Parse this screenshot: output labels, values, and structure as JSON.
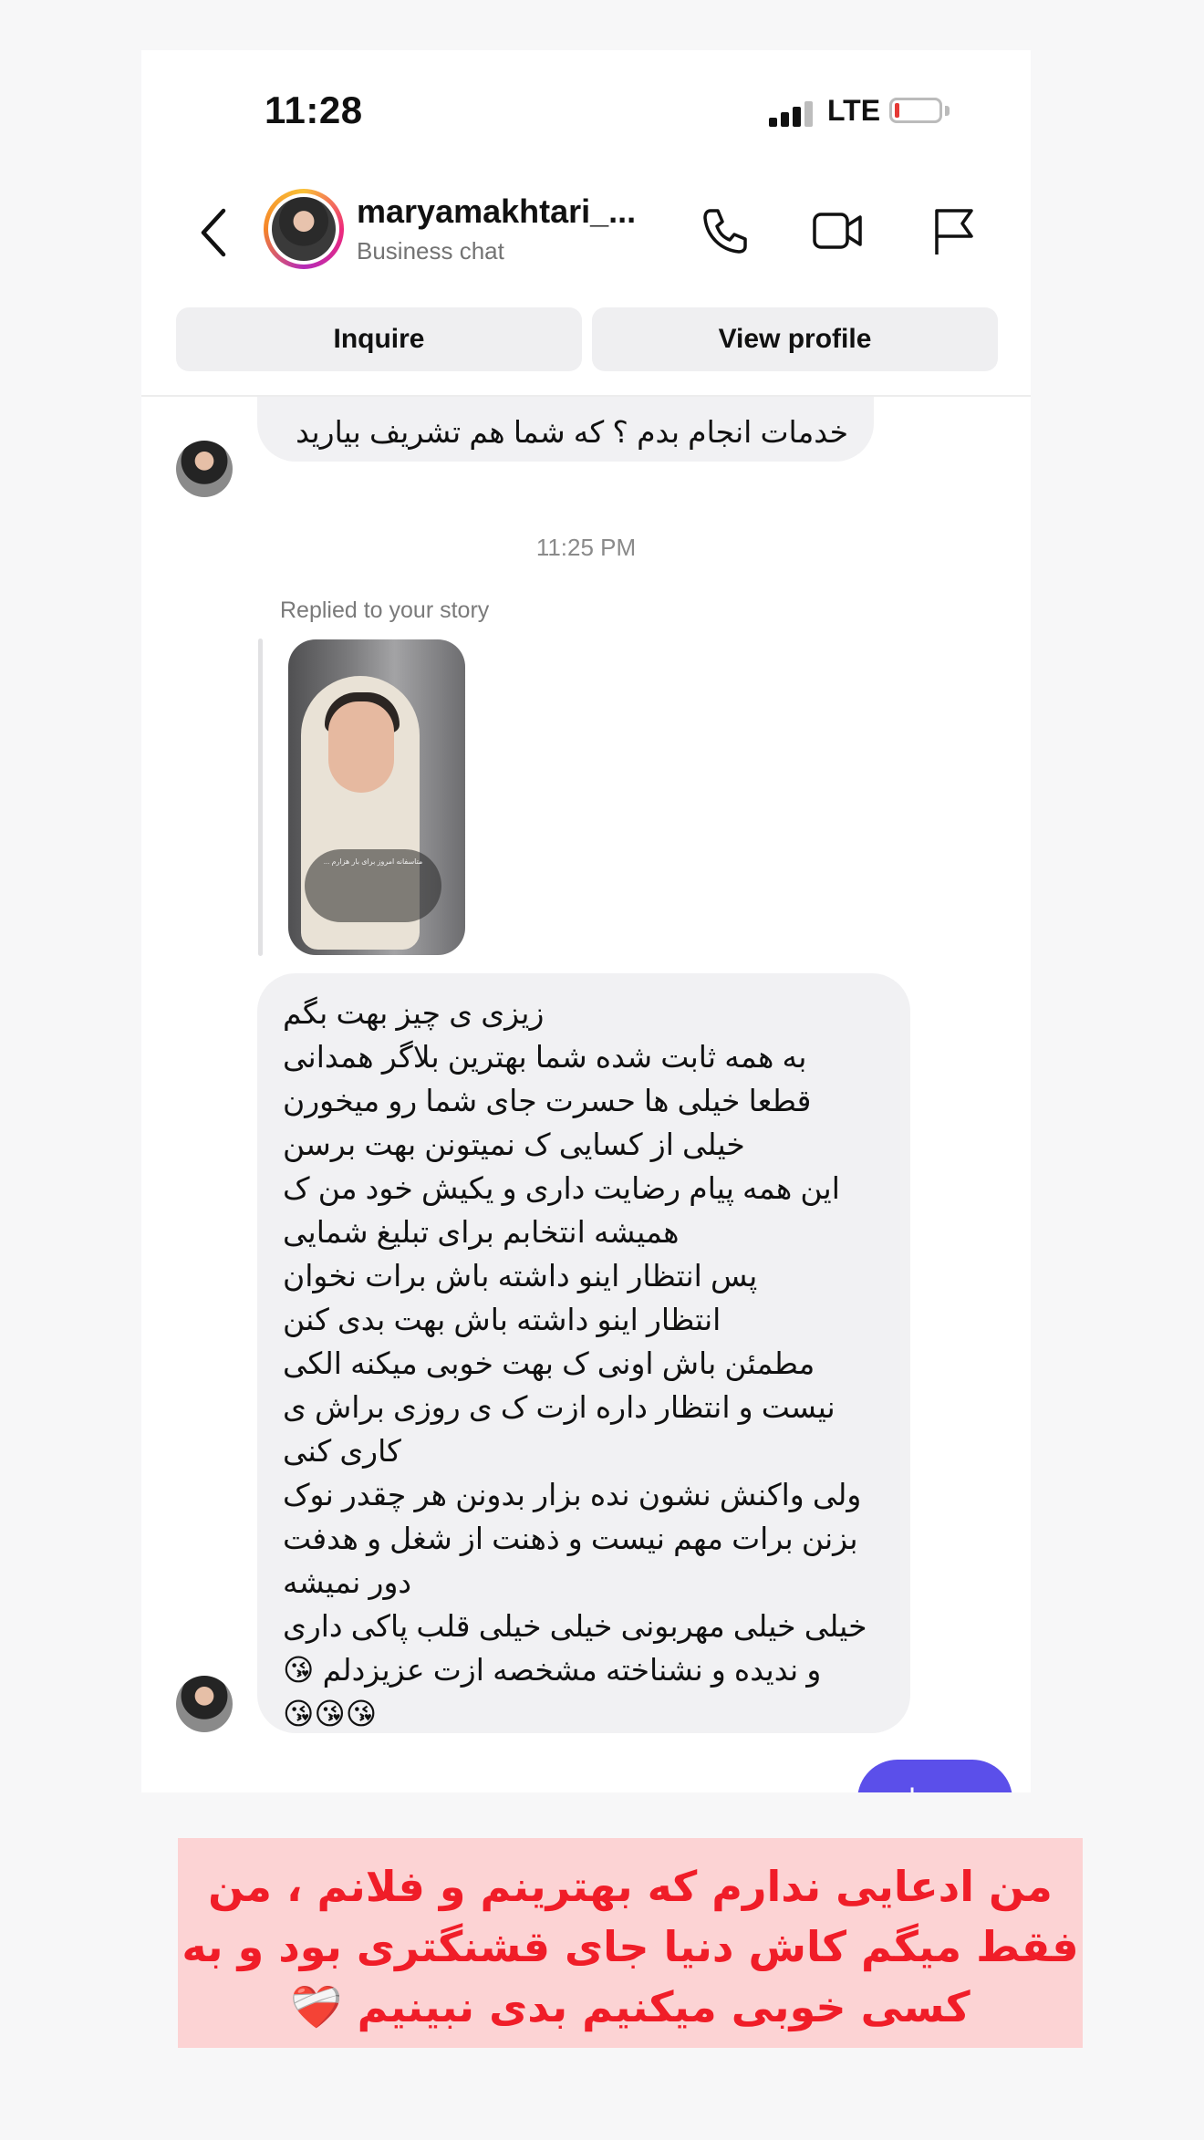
{
  "status_bar": {
    "time": "11:28",
    "network": "LTE"
  },
  "header": {
    "username": "maryamakhtari_...",
    "subtitle": "Business chat",
    "buttons": {
      "inquire": "Inquire",
      "view_profile": "View profile"
    }
  },
  "chat": {
    "top_partial_message": "خدمات انجام بدم ؟ که شما هم تشریف بیارید",
    "timestamp": "11:25 PM",
    "reply_label": "Replied to your story",
    "story_caption": "متاسفانه امروز برای بار هزارم ...",
    "long_message": "زیزی ی چیز بهت بگم\nبه همه ثابت شده شما بهترین بلاگر همدانی\nقطعا خیلی ها حسرت جای شما رو میخورن\nخیلی از کسایی ک نمیتونن بهت برسن\nاین همه پیام رضایت داری و یکیش خود من ک همیشه انتخابم برای تبلیغ شمایی\nپس انتظار اینو داشته باش برات نخوان\nانتظار اینو داشته باش بهت بدی کنن\nمطمئن باش اونی ک بهت خوبی میکنه الکی نیست و انتظار داره ازت ک ی روزی براش ی کاری کنی\nولی واکنش نشون نده بزار بدونن هر چقدر نوک بزنن برات مهم نیست و ذهنت از شغل و هدفت دور نمیشه\nخیلی خیلی مهربونی خیلی خیلی قلب پاکی داری و ندیده و نشناخته مشخصه ازت عزیزدلم 😘\n😘😘😘",
    "sent_message": "عزیزدلی"
  },
  "banner": {
    "text": "من ادعایی ندارم که بهترینم و فلانم ، من فقط میگم کاش دنیا جای قشنگتری بود و به کسی خوبی میکنیم بدی نبینیم ❤️‍🩹"
  },
  "colors": {
    "sent_bubble": "#5b4fea",
    "received_bubble": "#f1f1f3",
    "banner_bg": "#fcd3d4",
    "banner_text": "#f01d28"
  }
}
